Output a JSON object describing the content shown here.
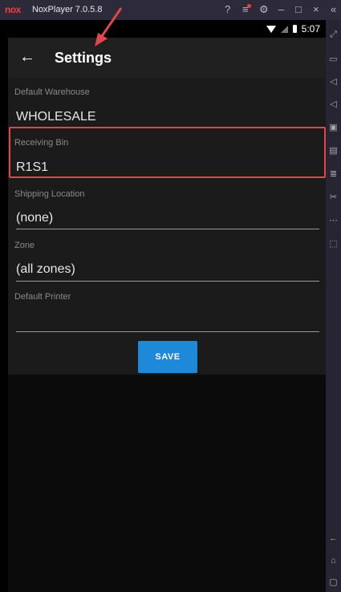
{
  "emulator": {
    "logo": "nox",
    "title": "NoxPlayer 7.0.5.8",
    "controls": {
      "help": "?",
      "menu": "≡",
      "settings": "⚙",
      "minimize": "–",
      "maximize": "□",
      "close": "×",
      "collapse": "«"
    },
    "side_icons": [
      "fullscreen-icon",
      "screen-icon",
      "volume-up-icon",
      "volume-down-icon",
      "screenshot-icon",
      "add-apk-icon",
      "multi-instance-icon",
      "scissors-icon",
      "more-icon",
      "resize-icon",
      "back-icon",
      "home-icon",
      "recent-icon"
    ]
  },
  "status_bar": {
    "time": "5:07"
  },
  "app_bar": {
    "back_icon": "←",
    "title": "Settings"
  },
  "fields": {
    "default_warehouse": {
      "label": "Default Warehouse",
      "value": "WHOLESALE"
    },
    "receiving_bin": {
      "label": "Receiving Bin",
      "value": "R1S1"
    },
    "shipping_location": {
      "label": "Shipping Location",
      "value": "(none)"
    },
    "zone": {
      "label": "Zone",
      "value": "(all zones)"
    },
    "default_printer": {
      "label": "Default Printer",
      "value": ""
    }
  },
  "buttons": {
    "save": "SAVE"
  },
  "colors": {
    "highlight": "#e0474c",
    "accent": "#1e88d9",
    "arrow": "#e0474c"
  }
}
